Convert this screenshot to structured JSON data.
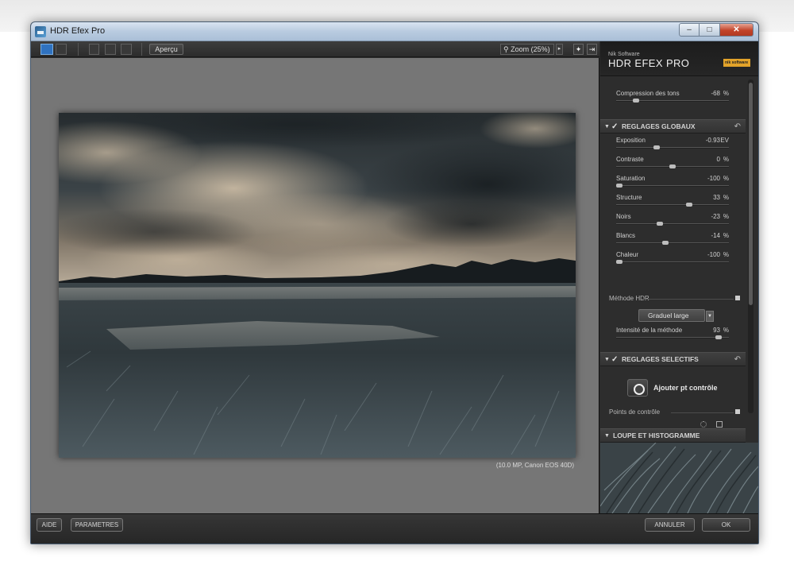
{
  "window": {
    "title": "HDR Efex Pro",
    "minimize_glyph": "–",
    "maximize_glyph": "□",
    "close_glyph": "✕"
  },
  "toolbar": {
    "preview_label": "Aperçu",
    "zoom_label": "Zoom (25%)",
    "zoom_arrow": "▸",
    "icons": [
      "view-single-icon",
      "view-split-icon",
      "frame-icon",
      "compare-icon",
      "dual-icon",
      "lightbulb-icon",
      "export-icon"
    ]
  },
  "photo": {
    "caption": "(10.0 MP, Canon EOS 40D)"
  },
  "panel": {
    "brand_small": "Nik Software",
    "brand_title": "HDR EFEX PRO",
    "logo_text": "nik software",
    "tone_compression": {
      "label": "Compression des tons",
      "value": "-68",
      "unit": "%",
      "level": 0.16
    },
    "global_section": {
      "label": "REGLAGES GLOBAUX",
      "reset": "↶"
    },
    "sliders": [
      {
        "label": "Exposition",
        "value": "-0.93",
        "unit": "EV",
        "level": 0.35
      },
      {
        "label": "Contraste",
        "value": "0",
        "unit": "%",
        "level": 0.5
      },
      {
        "label": "Saturation",
        "value": "-100",
        "unit": "%",
        "level": 0.0
      },
      {
        "label": "Structure",
        "value": "33",
        "unit": "%",
        "level": 0.66
      },
      {
        "label": "Noirs",
        "value": "-23",
        "unit": "%",
        "level": 0.38
      },
      {
        "label": "Blancs",
        "value": "-14",
        "unit": "%",
        "level": 0.43
      },
      {
        "label": "Chaleur",
        "value": "-100",
        "unit": "%",
        "level": 0.0
      }
    ],
    "hdr_method": {
      "label": "Méthode HDR",
      "dropdown_value": "Graduel large"
    },
    "method_intensity": {
      "label": "Intensité de la méthode",
      "value": "93",
      "unit": "%",
      "level": 0.93
    },
    "selective_section": {
      "label": "REGLAGES SELECTIFS",
      "reset": "↶"
    },
    "add_control_point": "Ajouter pt contrôle",
    "control_points_label": "Points de contrôle",
    "loupe_section": {
      "label": "LOUPE ET HISTOGRAMME"
    }
  },
  "bottom": {
    "help_label": "AIDE",
    "settings_label": "PARAMETRES",
    "cancel_label": "ANNULER",
    "ok_label": "OK"
  }
}
